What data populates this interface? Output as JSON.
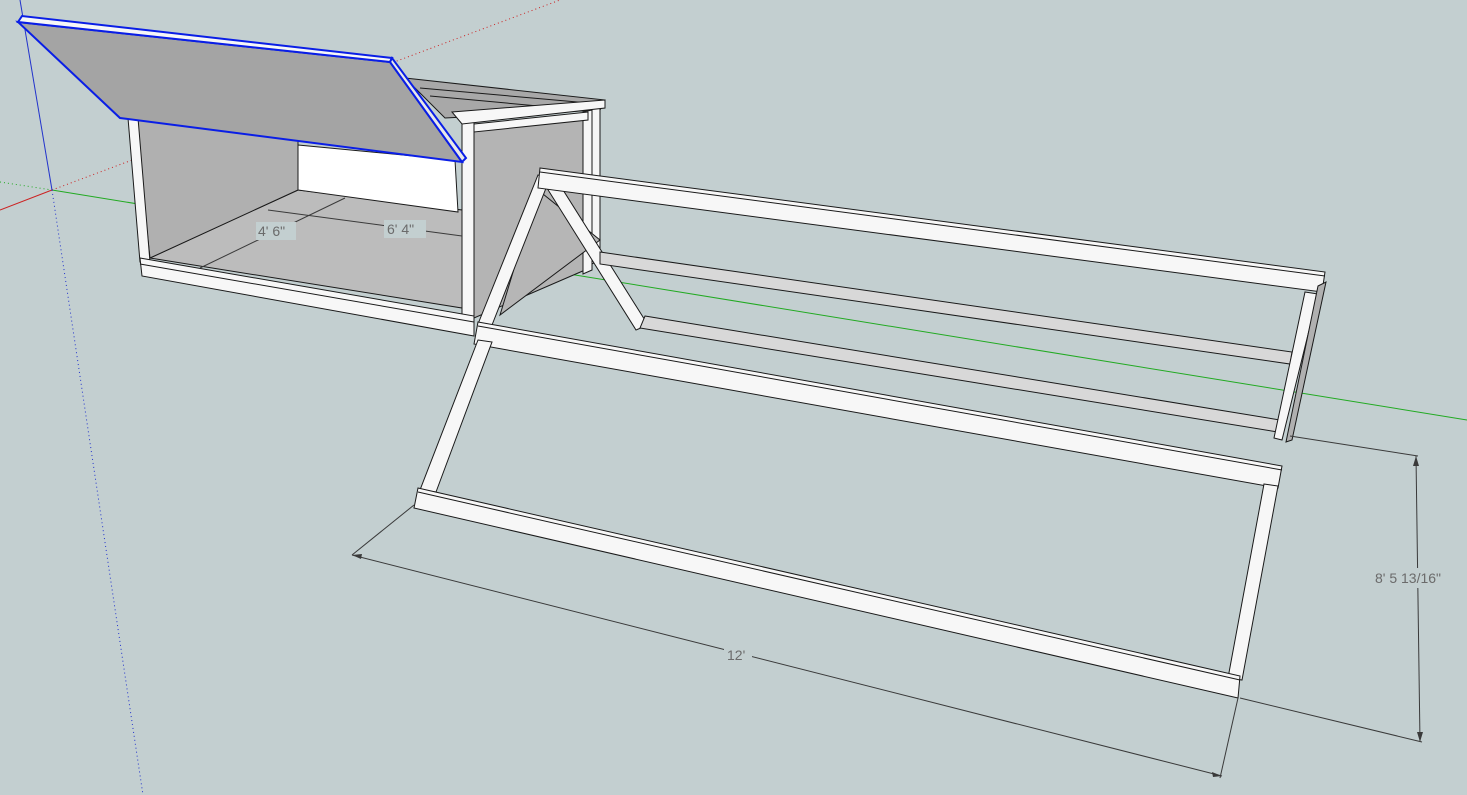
{
  "model": {
    "dimensions": {
      "coop_depth": "4' 6\"",
      "coop_width": "6' 4\"",
      "run_length": "12'",
      "run_height": "8' 5 13/16\""
    }
  },
  "colors": {
    "background": "#c3cfd0",
    "axis_red": "#cc2222",
    "axis_green": "#22aa22",
    "axis_blue": "#2233cc",
    "selection_blue": "#0a1ee6",
    "lumber": "#f7f7f7",
    "lumber_edge": "#1a1a1a",
    "panel_gray": "#aeaeae",
    "panel_light": "#bdbdbd",
    "dimension_line": "#3a3a3a"
  }
}
